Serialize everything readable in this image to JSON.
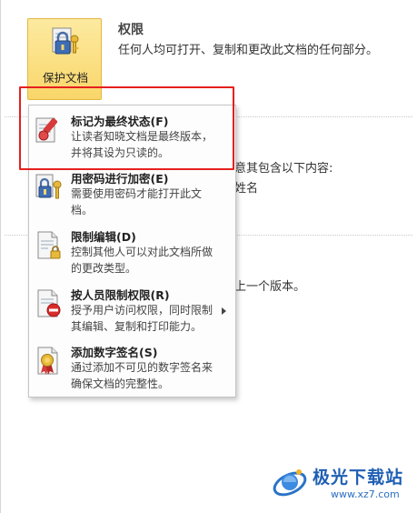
{
  "protect_button": {
    "label": "保护文档",
    "icon": "lock-key-icon"
  },
  "permissions": {
    "title": "权限",
    "description": "任何人均可打开、复制和更改此文档的任何部分。"
  },
  "background_text": {
    "line1": "意其包含以下内容:",
    "line2": "姓名",
    "line3": "上一个版本。"
  },
  "menu": {
    "items": [
      {
        "title": "标记为最终状态(F)",
        "desc": "让读者知晓文档是最终版本，\n并将其设为只读的。",
        "icon": "mark-final-icon"
      },
      {
        "title": "用密码进行加密(E)",
        "desc": "需要使用密码才能打开此文\n档。",
        "icon": "encrypt-password-icon"
      },
      {
        "title": "限制编辑(D)",
        "desc": "控制其他人可以对此文档所做\n的更改类型。",
        "icon": "restrict-editing-icon"
      },
      {
        "title": "按人员限制权限(R)",
        "desc": "授予用户访问权限，同时限制\n其编辑、复制和打印能力。",
        "icon": "restrict-by-people-icon"
      },
      {
        "title": "添加数字签名(S)",
        "desc": "通过添加不可见的数字签名来\n确保文档的完整性。",
        "icon": "digital-signature-icon"
      }
    ]
  },
  "watermark": {
    "title": "极光下载站",
    "url": "www.xz7.com"
  },
  "colors": {
    "highlight": "#e5201e",
    "button_bg": "#f9d66a",
    "watermark": "#1f5fb3"
  }
}
